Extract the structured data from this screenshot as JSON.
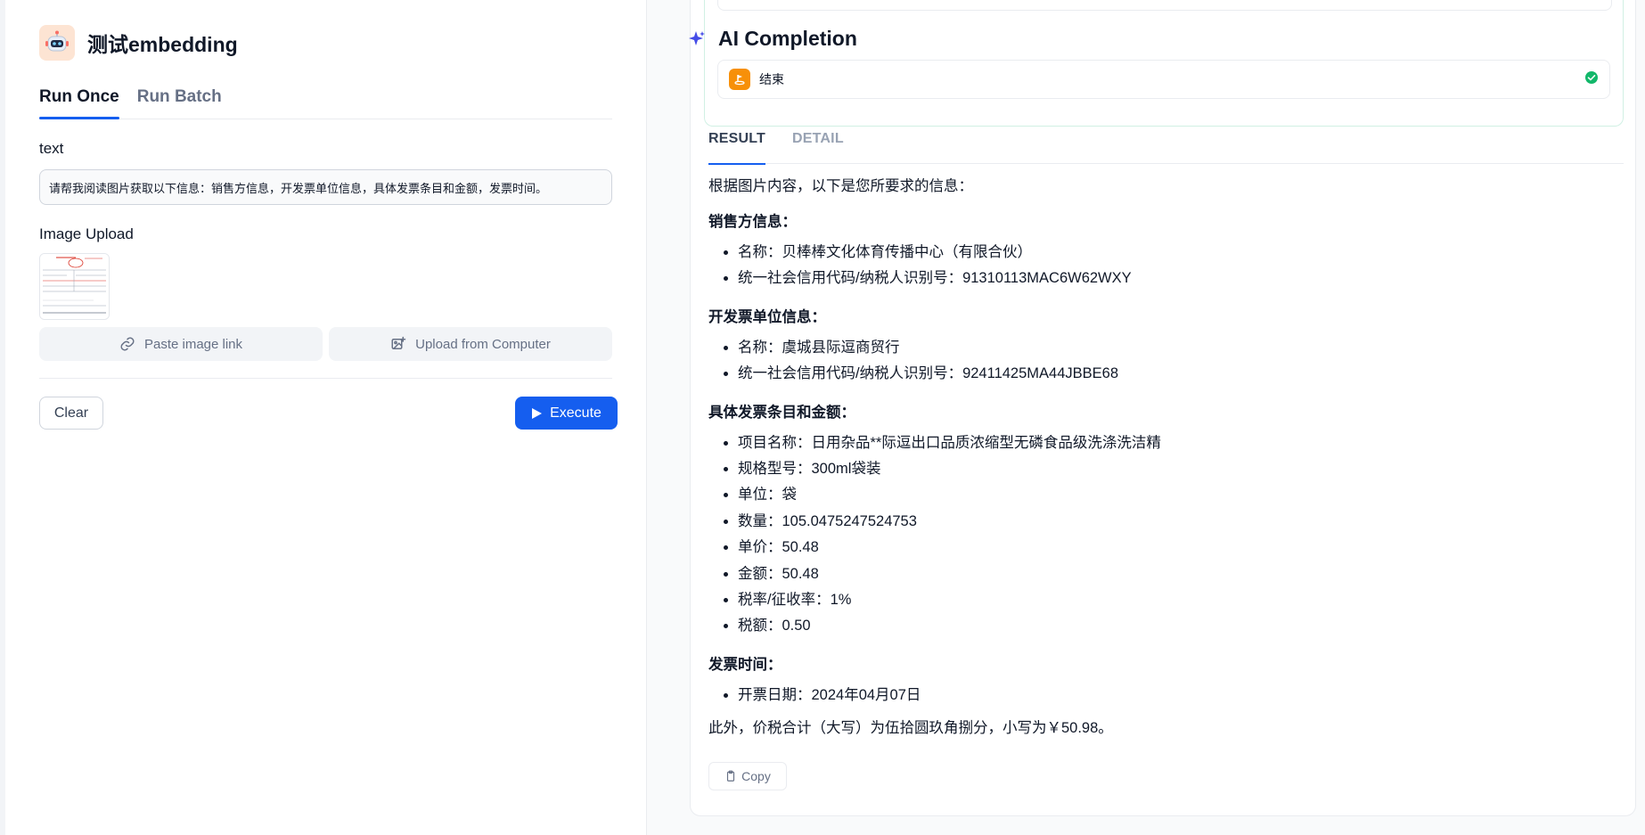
{
  "app": {
    "title": "测试embedding",
    "icon": "robot-avatar-icon"
  },
  "tabs": [
    {
      "label": "Run Once",
      "active": true
    },
    {
      "label": "Run Batch",
      "active": false
    }
  ],
  "form": {
    "text_label": "text",
    "text_value": "请帮我阅读图片获取以下信息：销售方信息，开发票单位信息，具体发票条目和金额，发票时间。",
    "image_label": "Image Upload",
    "paste_link_label": "Paste image link",
    "upload_computer_label": "Upload from Computer",
    "clear_label": "Clear",
    "execute_label": "Execute"
  },
  "completion": {
    "title": "AI Completion",
    "workflow": {
      "node_label": "结束",
      "node_status": "success"
    },
    "tabs": [
      {
        "label": "RESULT",
        "active": true
      },
      {
        "label": "DETAIL",
        "active": false
      }
    ],
    "result": {
      "intro": "根据图片内容，以下是您所要求的信息：",
      "sections": [
        {
          "heading": "销售方信息：",
          "items": [
            "名称：贝棒棒文化体育传播中心（有限合伙）",
            "统一社会信用代码/纳税人识别号：91310113MAC6W62WXY"
          ]
        },
        {
          "heading": "开发票单位信息：",
          "items": [
            "名称：虞城县际逗商贸行",
            "统一社会信用代码/纳税人识别号：92411425MA44JBBE68"
          ]
        },
        {
          "heading": "具体发票条目和金额：",
          "items": [
            "项目名称：日用杂品**际逗出口品质浓缩型无磷食品级洗涤洗洁精",
            "规格型号：300ml袋装",
            "单位：袋",
            "数量：105.0475247524753",
            "单价：50.48",
            "金额：50.48",
            "税率/征收率：1%",
            "税额：0.50"
          ]
        },
        {
          "heading": "发票时间：",
          "items": [
            "开票日期：2024年04月07日"
          ]
        }
      ],
      "footer": "此外，价税合计（大写）为伍拾圆玖角捌分，小写为￥50.98。"
    },
    "copy_label": "Copy"
  },
  "colors": {
    "accent": "#155eef",
    "success": "#12b76a",
    "node_icon_bg": "#f79009"
  }
}
